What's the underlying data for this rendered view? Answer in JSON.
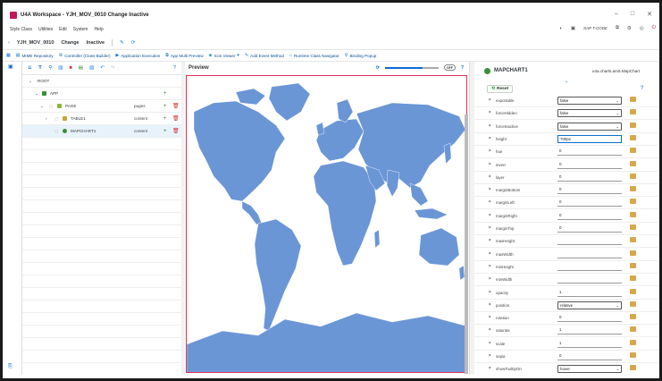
{
  "window": {
    "title": "U4A Workspace - YJH_MOV_0010 Change Inactive",
    "controls": [
      "–",
      "□",
      "✕"
    ]
  },
  "menu": {
    "items": [
      "Style Class",
      "Utilities",
      "Edit",
      "System",
      "Help"
    ],
    "tcode": "SAP T-CODE"
  },
  "header": {
    "app_id": "YJH_MOV_0010",
    "mode": "Change",
    "status": "Inactive"
  },
  "toolbar": {
    "items": [
      "MIME Repository",
      "Controller (Class Builder)",
      "Application Execution",
      "App Multi Preview",
      "Icon Viewer",
      "Add Event Method",
      "Runtime Class Navigator",
      "Binding Popup"
    ]
  },
  "tree": {
    "rows": [
      {
        "label": "ROOT",
        "agg": "",
        "actions": false
      },
      {
        "label": "APP",
        "agg": "",
        "actions": false
      },
      {
        "label": "PAGE",
        "agg": "pages",
        "actions": true
      },
      {
        "label": "TABLE1",
        "agg": "content",
        "actions": true
      },
      {
        "label": "MAPCHART1",
        "agg": "content",
        "actions": true
      }
    ]
  },
  "preview": {
    "title": "Preview",
    "toggle": "OFF"
  },
  "properties": {
    "title": "MAPCHART1",
    "control_class": "u4a.charts.am5.MapChart",
    "reset_label": "Reset",
    "rows": [
      {
        "name": "exportable",
        "value": "false",
        "type": "select"
      },
      {
        "name": "forceHidden",
        "value": "false",
        "type": "select"
      },
      {
        "name": "forceInactive",
        "value": "false",
        "type": "select"
      },
      {
        "name": "height",
        "value": "700px",
        "type": "active"
      },
      {
        "name": "hue",
        "value": "0",
        "type": "text"
      },
      {
        "name": "invert",
        "value": "0",
        "type": "text"
      },
      {
        "name": "layer",
        "value": "0",
        "type": "text"
      },
      {
        "name": "marginBottom",
        "value": "0",
        "type": "text"
      },
      {
        "name": "marginLeft",
        "value": "0",
        "type": "text"
      },
      {
        "name": "marginRight",
        "value": "0",
        "type": "text"
      },
      {
        "name": "marginTop",
        "value": "0",
        "type": "text"
      },
      {
        "name": "maxHeight",
        "value": "",
        "type": "text"
      },
      {
        "name": "maxWidth",
        "value": "",
        "type": "text"
      },
      {
        "name": "minHeight",
        "value": "",
        "type": "text"
      },
      {
        "name": "minWidth",
        "value": "",
        "type": "text"
      },
      {
        "name": "opacity",
        "value": "1",
        "type": "text"
      },
      {
        "name": "position",
        "value": "relative",
        "type": "select"
      },
      {
        "name": "rotation",
        "value": "0",
        "type": "text"
      },
      {
        "name": "saturate",
        "value": "1",
        "type": "text"
      },
      {
        "name": "scale",
        "value": "1",
        "type": "text"
      },
      {
        "name": "sepia",
        "value": "0",
        "type": "text"
      },
      {
        "name": "showTooltipOn",
        "value": "hover",
        "type": "select"
      }
    ]
  },
  "colors": {
    "accent": "#0a6ed1",
    "map_land": "#6b96d6",
    "folder": "#d7a84a"
  }
}
